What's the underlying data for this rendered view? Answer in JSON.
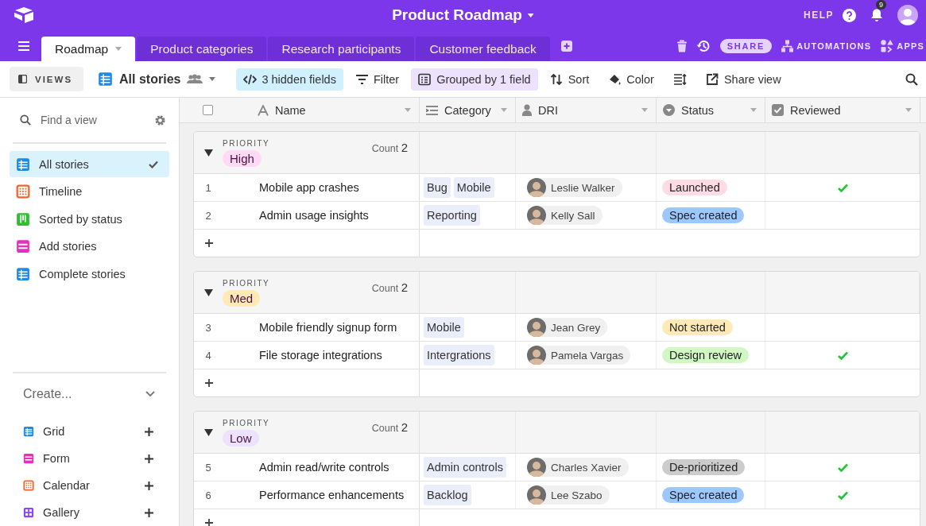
{
  "header": {
    "title": "Product Roadmap",
    "help": "HELP",
    "notifications": "9"
  },
  "tabs": [
    {
      "label": "Roadmap",
      "selected": true
    },
    {
      "label": "Product categories",
      "selected": false
    },
    {
      "label": "Research participants",
      "selected": false
    },
    {
      "label": "Customer feedback",
      "selected": false
    }
  ],
  "tab_actions": {
    "share": "SHARE",
    "automations": "AUTOMATIONS",
    "apps": "APPS"
  },
  "toolbar": {
    "views": "VIEWS",
    "view_name": "All stories",
    "buttons": [
      {
        "kind": "hidden",
        "label": "3 hidden fields",
        "active": true
      },
      {
        "kind": "filter",
        "label": "Filter",
        "active": false
      },
      {
        "kind": "group",
        "label": "Grouped by 1 field",
        "active": true
      },
      {
        "kind": "sort",
        "label": "Sort",
        "active": false
      },
      {
        "kind": "color",
        "label": "Color",
        "active": false
      },
      {
        "kind": "rowheight",
        "active": false
      },
      {
        "kind": "share",
        "label": "Share view",
        "active": false
      }
    ]
  },
  "sidebar": {
    "search": {
      "placeholder": "Find a view"
    },
    "views": [
      {
        "kind": "grid",
        "label": "All stories",
        "selected": true
      },
      {
        "kind": "timeline",
        "label": "Timeline",
        "selected": false
      },
      {
        "kind": "kanban",
        "label": "Sorted by status",
        "selected": false
      },
      {
        "kind": "form",
        "label": "Add stories",
        "selected": false
      },
      {
        "kind": "grid",
        "label": "Complete stories",
        "selected": false
      }
    ],
    "create_label": "Create...",
    "create": [
      {
        "kind": "grid",
        "label": "Grid"
      },
      {
        "kind": "form",
        "label": "Form"
      },
      {
        "kind": "calendar",
        "label": "Calendar"
      },
      {
        "kind": "gallery",
        "label": "Gallery"
      }
    ]
  },
  "table": {
    "select_all": {
      "checked": false
    },
    "columns": [
      {
        "kind": "text",
        "label": "Name"
      },
      {
        "kind": "multi",
        "label": "Category"
      },
      {
        "kind": "user",
        "label": "DRI"
      },
      {
        "kind": "select",
        "label": "Status"
      },
      {
        "kind": "check",
        "label": "Reviewed"
      }
    ],
    "groups": [
      {
        "field": "PRIORITY",
        "count_label": "Count",
        "value": "High",
        "color": "#ffdaf6",
        "count": "2",
        "expanded": true,
        "rows": [
          {
            "number": "1",
            "name": "Mobile app crashes",
            "categories": [
              "Bug",
              "Mobile"
            ],
            "dri": "Leslie Walker",
            "status": {
              "label": "Launched",
              "color": "#ffdce5"
            },
            "reviewed": true
          },
          {
            "number": "2",
            "name": "Admin usage insights",
            "categories": [
              "Reporting"
            ],
            "dri": "Kelly Sall",
            "status": {
              "label": "Spec created",
              "color": "#9cc7ff"
            },
            "reviewed": false
          }
        ]
      },
      {
        "field": "PRIORITY",
        "count_label": "Count",
        "value": "Med",
        "color": "#ffeab6",
        "count": "2",
        "expanded": true,
        "rows": [
          {
            "number": "3",
            "name": "Mobile friendly signup form",
            "categories": [
              "Mobile"
            ],
            "dri": "Jean Grey",
            "status": {
              "label": "Not started",
              "color": "#ffeab6"
            },
            "reviewed": false
          },
          {
            "number": "4",
            "name": "File storage integrations",
            "categories": [
              "Intergrations"
            ],
            "dri": "Pamela Vargas",
            "status": {
              "label": "Design review",
              "color": "#d1f7c4"
            },
            "reviewed": true
          }
        ]
      },
      {
        "field": "PRIORITY",
        "count_label": "Count",
        "value": "Low",
        "color": "#ede2fe",
        "count": "2",
        "expanded": true,
        "rows": [
          {
            "number": "5",
            "name": "Admin read/write controls",
            "categories": [
              "Admin controls"
            ],
            "dri": "Charles Xavier",
            "status": {
              "label": "De-prioritized",
              "color": "#cccccc"
            },
            "reviewed": true
          },
          {
            "number": "6",
            "name": "Performance enhancements",
            "categories": [
              "Backlog"
            ],
            "dri": "Lee Szabo",
            "status": {
              "label": "Spec created",
              "color": "#9cc7ff"
            },
            "reviewed": true
          }
        ]
      }
    ]
  }
}
